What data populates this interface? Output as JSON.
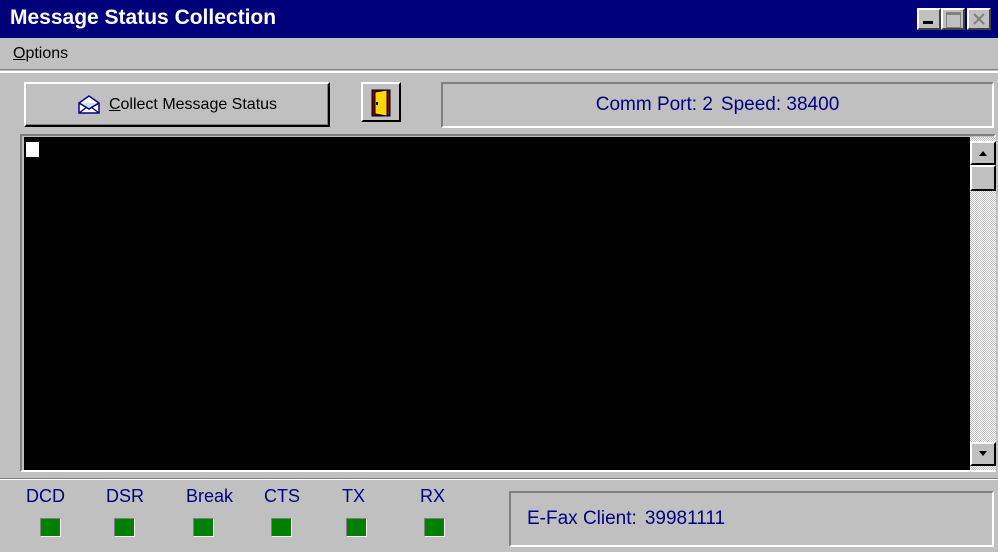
{
  "window": {
    "title": "Message Status Collection"
  },
  "menu": {
    "options_accel": "O",
    "options_rest": "ptions"
  },
  "toolbar": {
    "collect_button_accel": "C",
    "collect_button_rest": "ollect Message Status",
    "collect_icon": "envelope-icon",
    "exit_icon": "door-icon"
  },
  "comm": {
    "port_label": "Comm Port: 2",
    "speed_label": "Speed: 38400"
  },
  "terminal": {
    "content": "",
    "background": "#000000"
  },
  "status": {
    "leds": [
      {
        "label": "DCD",
        "color": "#008000"
      },
      {
        "label": "DSR",
        "color": "#008000"
      },
      {
        "label": "Break",
        "color": "#008000"
      },
      {
        "label": "CTS",
        "color": "#008000"
      },
      {
        "label": "TX",
        "color": "#008000"
      },
      {
        "label": "RX",
        "color": "#008000"
      }
    ],
    "client_label": "E-Fax Client:",
    "client_id": "39981111"
  }
}
